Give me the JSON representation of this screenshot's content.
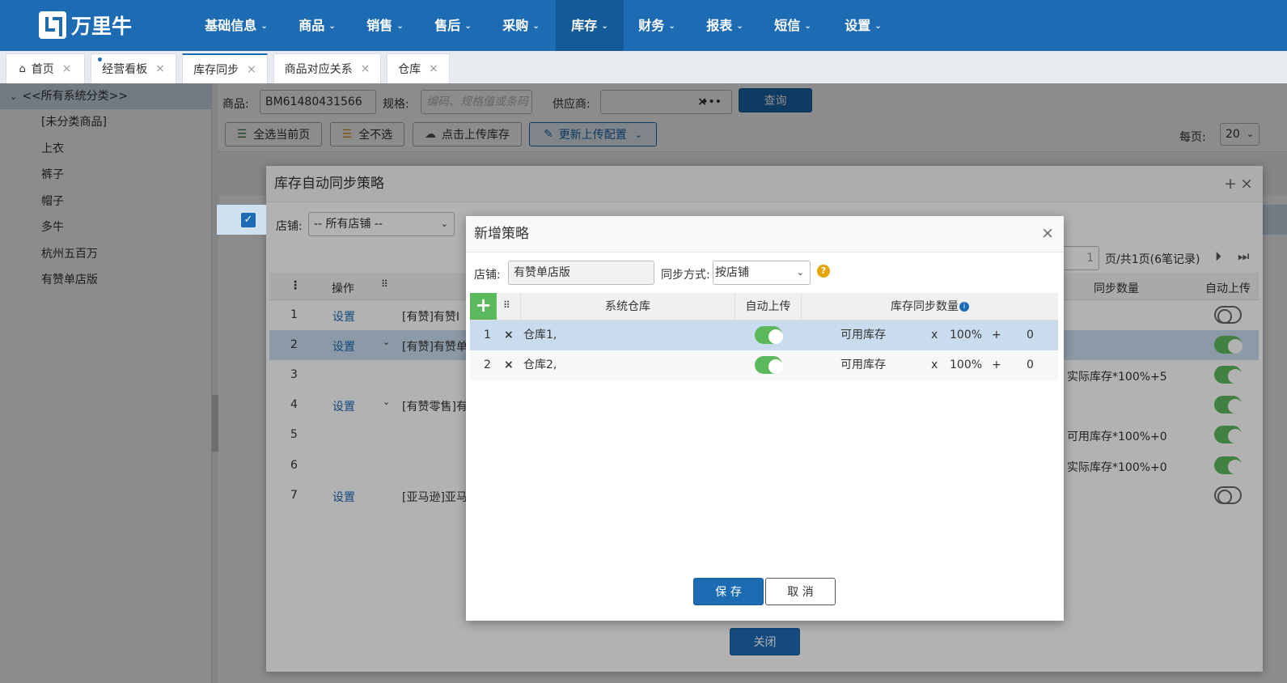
{
  "nav": {
    "logo_text": "万里牛",
    "items": [
      "基础信息",
      "商品",
      "销售",
      "售后",
      "采购",
      "库存",
      "财务",
      "报表",
      "短信",
      "设置"
    ],
    "active_index": 5
  },
  "tabs": [
    {
      "label": "首页"
    },
    {
      "label": "经营看板"
    },
    {
      "label": "库存同步"
    },
    {
      "label": "商品对应关系"
    },
    {
      "label": "仓库"
    }
  ],
  "sidebar": {
    "root": "<<所有系统分类>>",
    "items": [
      "[未分类商品]",
      "上衣",
      "裤子",
      "帽子",
      "多牛",
      "杭州五百万",
      "有赞单店版"
    ]
  },
  "filters": {
    "product_label": "商品:",
    "product_value": "BM61480431566",
    "spec_label": "规格:",
    "spec_placeholder": "编码、规格值或条码",
    "supplier_label": "供应商:",
    "query": "查询"
  },
  "toolbar": {
    "select_page": "全选当前页",
    "deselect_all": "全不选",
    "upload": "点击上传库存",
    "update_config": "更新上传配置",
    "per_page_label": "每页:",
    "per_page": "20"
  },
  "outer_modal": {
    "title": "库存自动同步策略",
    "shop_label": "店铺:",
    "shop_value": "-- 所有店铺 --",
    "pager": "页/共1页(6笔记录)",
    "page_num": "1",
    "col_op": "操作",
    "col_sync_qty": "同步数量",
    "col_auto": "自动上传",
    "close": "关闭",
    "rows": [
      {
        "no": "1",
        "op": "设置",
        "name": "[有赞]有赞I",
        "sync": "",
        "auto": false
      },
      {
        "no": "2",
        "op": "设置",
        "name": "[有赞]有赞单",
        "sync": "",
        "auto": true
      },
      {
        "no": "3",
        "op": "",
        "name": "",
        "sync": "实际库存*100%+5",
        "auto": true
      },
      {
        "no": "4",
        "op": "设置",
        "name": "[有赞零售]有",
        "sync": "",
        "auto": true
      },
      {
        "no": "5",
        "op": "",
        "name": "",
        "sync": "可用库存*100%+0",
        "auto": true
      },
      {
        "no": "6",
        "op": "",
        "name": "",
        "sync": "实际库存*100%+0",
        "auto": true
      },
      {
        "no": "7",
        "op": "设置",
        "name": "[亚马逊]亚马",
        "sync": "",
        "auto": false
      }
    ]
  },
  "inner_modal": {
    "title": "新增策略",
    "shop_label": "店铺:",
    "shop_value": "有赞单店版",
    "sync_mode_label": "同步方式:",
    "sync_mode_value": "按店铺",
    "col_warehouse": "系统仓库",
    "col_auto": "自动上传",
    "col_qty": "库存同步数量",
    "save": "保 存",
    "cancel": "取 消",
    "rows": [
      {
        "no": "1",
        "warehouse": "仓库1,",
        "auto": true,
        "stock_type": "可用库存",
        "mult": "x",
        "pct": "100%",
        "plus": "+",
        "add": "0"
      },
      {
        "no": "2",
        "warehouse": "仓库2,",
        "auto": true,
        "stock_type": "可用库存",
        "mult": "x",
        "pct": "100%",
        "plus": "+",
        "add": "0"
      }
    ]
  },
  "colors": {
    "primary": "#1d6bb3",
    "toggle_on": "#5cb85c",
    "selected_row": "#c9dcee"
  }
}
